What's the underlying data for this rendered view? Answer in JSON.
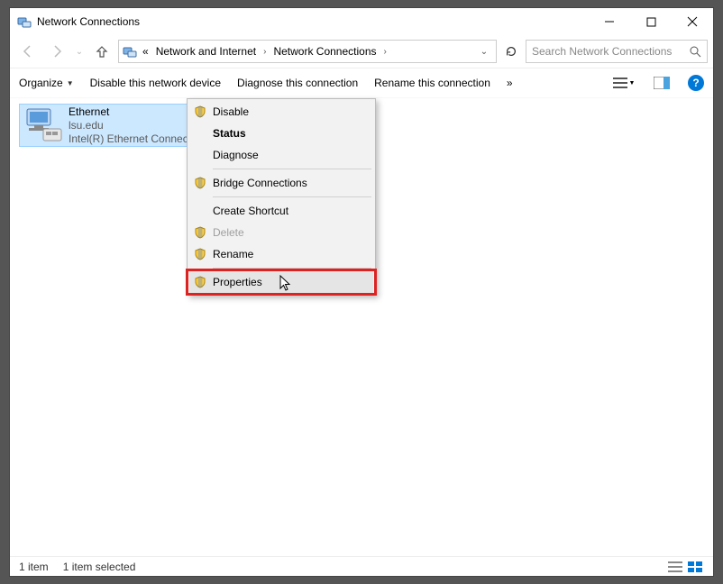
{
  "window": {
    "title": "Network Connections"
  },
  "breadcrumbs": {
    "more": "«",
    "b1": "Network and Internet",
    "b2": "Network Connections"
  },
  "search": {
    "placeholder": "Search Network Connections"
  },
  "toolbar": {
    "organize": "Organize",
    "disable": "Disable this network device",
    "diagnose": "Diagnose this connection",
    "rename": "Rename this connection",
    "more": "»"
  },
  "item": {
    "name": "Ethernet",
    "domain": "lsu.edu",
    "adapter": "Intel(R) Ethernet Connection…"
  },
  "context_menu": {
    "disable": "Disable",
    "status": "Status",
    "diagnose": "Diagnose",
    "bridge": "Bridge Connections",
    "shortcut": "Create Shortcut",
    "delete": "Delete",
    "rename": "Rename",
    "properties": "Properties"
  },
  "status": {
    "count": "1 item",
    "selected": "1 item selected"
  }
}
